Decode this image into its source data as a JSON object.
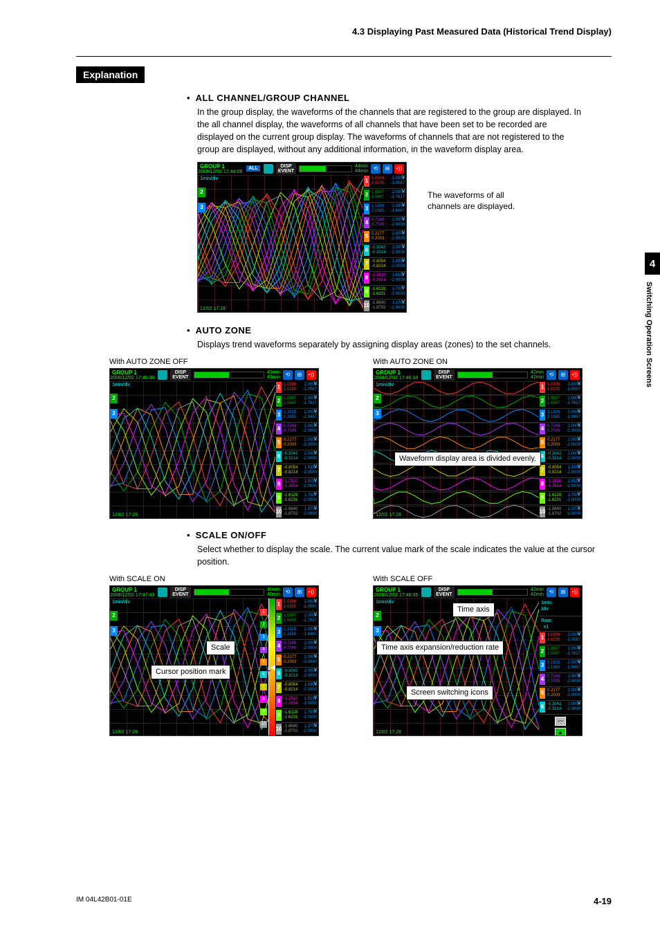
{
  "header": {
    "section_number_title": "4.3  Displaying Past Measured Data (Historical Trend Display)"
  },
  "explanation_tag": "Explanation",
  "side_tab": {
    "num": "4",
    "text": "Switching Operation Screens"
  },
  "s1": {
    "heading": "ALL CHANNEL/GROUP CHANNEL",
    "body": "In the group display, the waveforms of the channels that are registered to the group are displayed. In the all channel display, the waveforms of all channels that have been set to be recorded are displayed on the current group display. The waveforms of channels that are not registered to the group are displayed, without any additional information, in the waveform display area.",
    "side_note": "The waveforms of all channels are displayed."
  },
  "s2": {
    "heading": "AUTO ZONE",
    "body": "Displays trend waveforms separately by assigning display areas (zones) to the set channels.",
    "cap_left": "With AUTO ZONE OFF",
    "cap_right": "With AUTO ZONE ON",
    "callout": "Waveform display area is divided evenly."
  },
  "s3": {
    "heading": "SCALE ON/OFF",
    "body": "Select whether to display the scale. The current value mark of the scale indicates the value at the cursor position.",
    "cap_left": "With SCALE ON",
    "cap_right": "With SCALE OFF",
    "callout_scale": "Scale",
    "callout_cursor": "Cursor position mark",
    "callout_timeaxis": "Time axis",
    "callout_rate": "Time axis expansion/reduction rate",
    "callout_icons": "Screen switching icons",
    "timeaxis_label_1": "1min",
    "timeaxis_label_2": "/div",
    "rate_label_1": "Rate:",
    "rate_label_2": "x1"
  },
  "ss": {
    "group": "GROUP 1",
    "dt1": "2008/12/02 17:44:08",
    "dt2": "2008/12/02 17:45:30",
    "dt3": "2008/12/02 17:46:18",
    "dt4": "2008/12/02 17:47:43",
    "dt5": "2008/12/02 17:46:35",
    "all": "ALL",
    "disp_l1": "DISP",
    "disp_l2": "EVENT",
    "t1": "44min",
    "t2": "43min",
    "t3": "42min",
    "t4": "40min",
    "ts": "12/02 17:28",
    "scale_label": "1min/div",
    "channels": [
      {
        "n": "1",
        "unit": "V",
        "a": "1.0306",
        "b": "2.0000",
        "c": "1.0235",
        "d": "-1.0567",
        "col": "#f33"
      },
      {
        "n": "2",
        "unit": "V",
        "a": "1.5597",
        "b": "2.0000",
        "c": "1.5697",
        "d": "-1.7617",
        "col": "#0a0"
      },
      {
        "n": "3",
        "unit": "V",
        "a": "1.1826",
        "b": "2.0000",
        "c": "1.1685",
        "d": "-1.9467",
        "col": "#08f"
      },
      {
        "n": "4",
        "unit": "V",
        "a": "0.7248",
        "b": "2.0000",
        "c": "0.7005",
        "d": "-2.0000",
        "col": "#a3f"
      },
      {
        "n": "5",
        "unit": "V",
        "a": "0.2177",
        "b": "2.0000",
        "c": "0.2003",
        "d": "-2.0000",
        "col": "#f80"
      },
      {
        "n": "6",
        "unit": "V",
        "a": "-0.3042",
        "b": "2.0000",
        "c": "-0.3214",
        "d": "-2.0000",
        "col": "#0cc"
      },
      {
        "n": "7",
        "unit": "V",
        "a": "-0.8054",
        "b": "1.9350",
        "c": "-0.8214",
        "d": "-2.0000",
        "col": "#cc0"
      },
      {
        "n": "8",
        "unit": "V",
        "a": "-1.2510",
        "b": "1.9151",
        "c": "-1.2654",
        "d": "-2.0000",
        "col": "#f0f"
      },
      {
        "n": "9",
        "unit": "V",
        "a": "-1.6128",
        "b": "1.7007",
        "c": "-1.6231",
        "d": "-2.0000",
        "col": "#6f0"
      },
      {
        "n": "10",
        "unit": "V",
        "a": "-1.8640",
        "b": "1.3703",
        "c": "-1.8702",
        "d": "-2.0000",
        "col": "#999"
      }
    ]
  },
  "footer": {
    "code": "IM 04L42B01-01E",
    "page": "4-19"
  }
}
